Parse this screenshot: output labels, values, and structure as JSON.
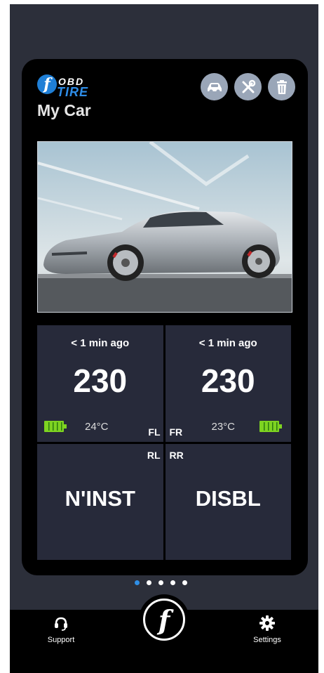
{
  "brand": {
    "logo_glyph": "f",
    "logo_top": "OBD",
    "logo_bottom": "TIRE"
  },
  "car": {
    "name": "My Car"
  },
  "header_icons": [
    "car-settings-icon",
    "tools-icon",
    "trash-icon"
  ],
  "tires": {
    "fl": {
      "position": "FL",
      "last_update": "< 1 min ago",
      "pressure": "230",
      "temperature": "24°C",
      "battery": "full"
    },
    "fr": {
      "position": "FR",
      "last_update": "< 1 min ago",
      "pressure": "230",
      "temperature": "23°C",
      "battery": "full"
    },
    "rl": {
      "position": "RL",
      "status": "N'INST"
    },
    "rr": {
      "position": "RR",
      "status": "DISBL"
    }
  },
  "pagination": {
    "total": 5,
    "active_index": 0
  },
  "bottom_nav": {
    "support_label": "Support",
    "settings_label": "Settings",
    "center_glyph": "f"
  },
  "colors": {
    "accent": "#2f8fe6",
    "tile_bg": "#272a3a",
    "battery": "#7ed321",
    "icon_button": "#9aa6b8"
  }
}
